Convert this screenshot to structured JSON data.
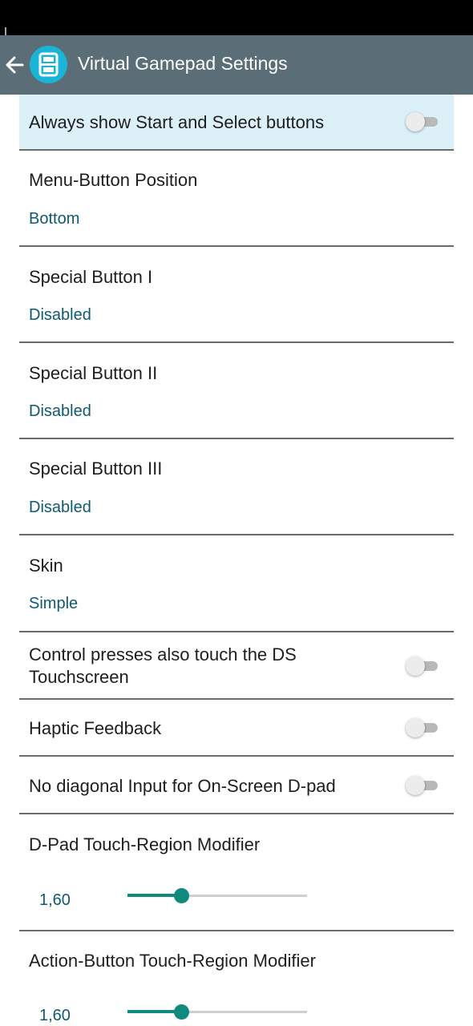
{
  "app_bar": {
    "title": "Virtual Gamepad Settings",
    "back_icon": "arrow-left-icon",
    "logo_icon": "ds-console-icon",
    "background": "#5b6e77"
  },
  "settings": {
    "always_show_start_select": {
      "label": "Always show Start and Select buttons",
      "enabled": false
    },
    "menu_button_position": {
      "label": "Menu-Button Position",
      "value": "Bottom"
    },
    "special_button_1": {
      "label": "Special Button I",
      "value": "Disabled"
    },
    "special_button_2": {
      "label": "Special Button II",
      "value": "Disabled"
    },
    "special_button_3": {
      "label": "Special Button III",
      "value": "Disabled"
    },
    "skin": {
      "label": "Skin",
      "value": "Simple"
    },
    "control_touch_ds": {
      "label": "Control presses also touch the DS Touchscreen",
      "enabled": false
    },
    "haptic_feedback": {
      "label": "Haptic Feedback",
      "enabled": false
    },
    "no_diagonal_dpad": {
      "label": "No diagonal Input for On-Screen D-pad",
      "enabled": false
    },
    "dpad_touch_region": {
      "label": "D-Pad Touch-Region Modifier",
      "value": "1,60",
      "slider_fraction": 0.3
    },
    "action_touch_region": {
      "label": "Action-Button Touch-Region Modifier",
      "value": "1,60",
      "slider_fraction": 0.3
    }
  },
  "colors": {
    "accent": "#0f8a7c",
    "summary_text": "#0f5a70",
    "highlight_row": "#dcf0f8"
  }
}
